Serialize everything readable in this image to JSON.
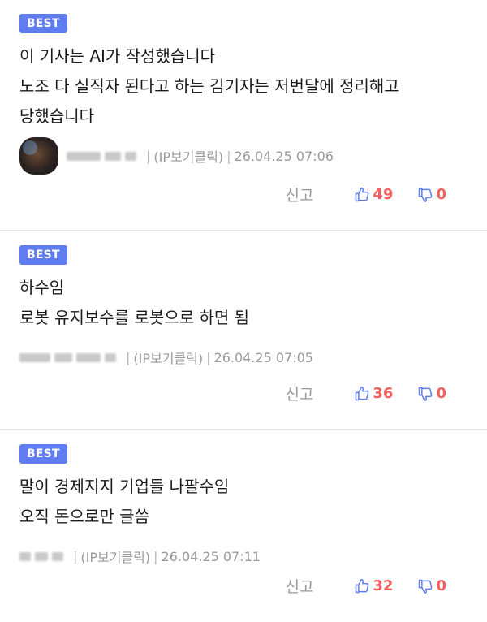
{
  "comments": [
    {
      "badge": "BEST",
      "lines": [
        "이 기사는 AI가 작성했습니다",
        "노조 다 실직자 된다고 하는 김기자는 저번달에 정리해고",
        "당했습니다"
      ],
      "ip_label": "(IP보기클릭)",
      "timestamp": "26.04.25 07:06",
      "report_label": "신고",
      "likes": "49",
      "dislikes": "0"
    },
    {
      "badge": "BEST",
      "lines": [
        "하수임",
        "로봇 유지보수를 로봇으로 하면 됨"
      ],
      "ip_label": "(IP보기클릭)",
      "timestamp": "26.04.25 07:05",
      "report_label": "신고",
      "likes": "36",
      "dislikes": "0"
    },
    {
      "badge": "BEST",
      "lines": [
        "말이 경제지지 기업들 나팔수임",
        "오직 돈으로만 글씀"
      ],
      "ip_label": "(IP보기클릭)",
      "timestamp": "26.04.25 07:11",
      "report_label": "신고",
      "likes": "32",
      "dislikes": "0"
    }
  ],
  "colors": {
    "badge": "#5f7cf0",
    "like_icon": "#5f7cf0",
    "count": "#f26060",
    "muted": "#9a9a9a"
  },
  "icons": {
    "like": "thumbs-up-icon",
    "dislike": "thumbs-down-icon"
  }
}
